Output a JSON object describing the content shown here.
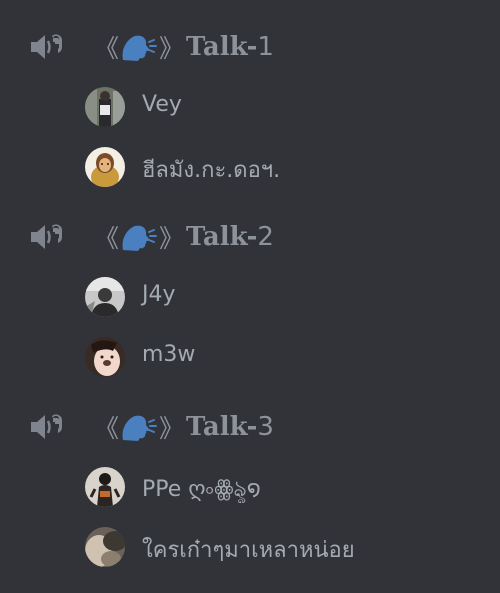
{
  "channels": [
    {
      "icon": "voice-speaker-icon",
      "bracket_open": "《",
      "emoji": "speaking-head-emoji",
      "bracket_close": "》",
      "label": "Talk-",
      "number": "1",
      "members": [
        {
          "name": "Vey",
          "avatar": "avatar-photo-standing-person"
        },
        {
          "name": "ฮีลมัง.กะ.ดอฯ.",
          "avatar": "avatar-cartoon-character"
        }
      ]
    },
    {
      "icon": "voice-speaker-icon",
      "bracket_open": "《",
      "emoji": "speaking-head-emoji",
      "bracket_close": "》",
      "label": "Talk-",
      "number": "2",
      "members": [
        {
          "name": "J4y",
          "avatar": "avatar-grayscale-photo"
        },
        {
          "name": "m3w",
          "avatar": "avatar-face-filter-photo"
        }
      ]
    },
    {
      "icon": "voice-speaker-icon",
      "bracket_open": "《",
      "emoji": "speaking-head-emoji",
      "bracket_close": "》",
      "label": "Talk-",
      "number": "3",
      "members": [
        {
          "name": "PPe ღ৹ꙮৡ໑",
          "avatar": "avatar-photo-dark-person"
        },
        {
          "name": "ใครเก๋าๆมาเหลาหน่อย",
          "avatar": "avatar-blurred-photo"
        }
      ]
    }
  ],
  "colors": {
    "background": "#313338",
    "channel_text": "#8e939b",
    "member_text": "#a4aab2",
    "emoji_blue": "#4a7fc0"
  }
}
